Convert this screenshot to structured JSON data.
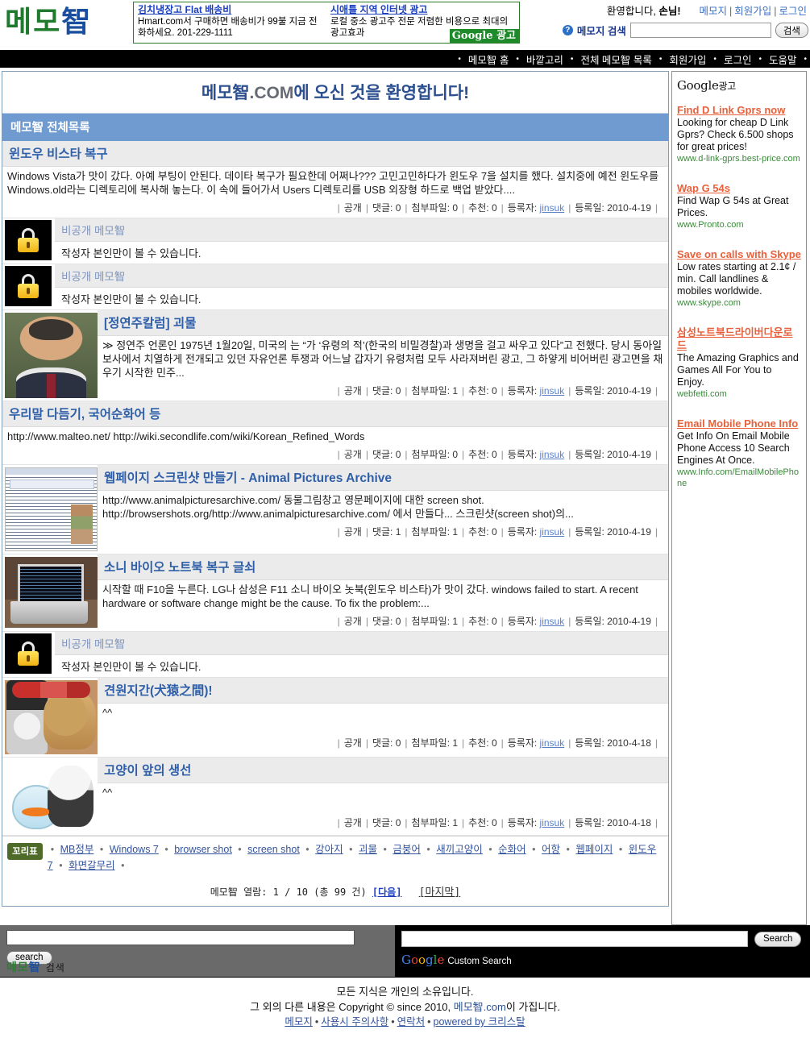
{
  "site": {
    "logo_part1": "메모",
    "logo_part2": "智",
    "title": "메모智.COM에 오신 것을 환영합니다!",
    "title_brand": "메모智",
    "title_dim": ".COM",
    "title_rest": "에 오신 것을 환영합니다!"
  },
  "top_ads": {
    "google_badge": "Google 광고",
    "items": [
      {
        "title": "김치냉장고 Flat 배송비",
        "text": "Hmart.com서 구매하면 배송비가 99불 지금 전화하세요. 201-229-1111"
      },
      {
        "title": "시애틀 지역 인터넷 광고",
        "text": "로컬 중소 광고주 전문 저렴한 비용으로 최대의 광고효과"
      }
    ]
  },
  "header": {
    "welcome": "환영합니다, ",
    "guest": "손님!",
    "links": [
      "메모지",
      "회원가입",
      "로그인"
    ],
    "search_label": "메모지 검색",
    "search_value": "",
    "search_button": "검색",
    "help_icon": "?"
  },
  "nav": {
    "items": [
      "메모智 홈",
      "바깥고리",
      "전체 메모智 목록",
      "회원가입",
      "로그인",
      "도움말"
    ]
  },
  "list": {
    "heading": "메모智 전체목록",
    "meta_labels": {
      "visibility": "공개",
      "comments": "댓글",
      "attachments": "첨부파일",
      "recommend": "추천",
      "author": "등록자",
      "date": "등록일"
    },
    "private_title": "비공개 메모智",
    "private_text": "작성자 본인만이 볼 수 있습니다.",
    "posts": [
      {
        "type": "text",
        "title": "윈도우 비스타 복구",
        "desc": "Windows Vista가 맛이 갔다. 아예 부팅이 안된다. 데이타 복구가 필요한데 어쩌나??? 고민고민하다가 윈도우 7을 설치를 했다. 설치중에 예전 윈도우를 Windows.old라는 디렉토리에 복사해 놓는다. 이 속에 들어가서 Users 디렉토리를 USB 외장형 하드로 백업 받았다....",
        "visibility": "공개",
        "comments": "0",
        "attachments": "0",
        "recommend": "0",
        "author": "jinsuk",
        "date": "2010-4-19"
      },
      {
        "type": "private"
      },
      {
        "type": "private"
      },
      {
        "type": "image",
        "thumb": "person-photo",
        "title": "[정연주칼럼] 괴물",
        "desc": "≫ 정연주 언론인 1975년 1월20일, 미국의 는 “가 ‘유령의 적’(한국의 비밀경찰)과 생명을 걸고 싸우고 있다”고 전했다. 당시 동아일보사에서 치열하게 전개되고 있던 자유언론 투쟁과 어느날 갑자기 유령처럼 모두 사라져버린 광고, 그 하얗게 비어버린 광고면을 채우기 시작한 민주...",
        "visibility": "공개",
        "comments": "0",
        "attachments": "1",
        "recommend": "0",
        "author": "jinsuk",
        "date": "2010-4-19"
      },
      {
        "type": "text",
        "title": "우리말 다듬기, 국어순화어 등",
        "desc": "http://www.malteo.net/ http://wiki.secondlife.com/wiki/Korean_Refined_Words",
        "visibility": "공개",
        "comments": "0",
        "attachments": "0",
        "recommend": "0",
        "author": "jinsuk",
        "date": "2010-4-19"
      },
      {
        "type": "image",
        "thumb": "webpage-screenshot",
        "title": "웹페이지 스크린샷 만들기 - Animal Pictures Archive",
        "desc": "http://www.animalpicturesarchive.com/ 동물그림창고 영문페이지에 대한 screen shot. http://browsershots.org/http://www.animalpicturesarchive.com/ 에서 만들다... 스크린샷(screen shot)의...",
        "visibility": "공개",
        "comments": "1",
        "attachments": "1",
        "recommend": "0",
        "author": "jinsuk",
        "date": "2010-4-19"
      },
      {
        "type": "image",
        "thumb": "laptop-photo",
        "title": "소니 바이오 노트북 복구 글쇠",
        "desc": "시작할 때 F10을 누른다. LG나 삼성은 F11 소니 바이오 놋북(윈도우 비스타)가 맛이 갔다. windows failed to start. A recent hardware or software change might be the cause. To fix the problem:...",
        "visibility": "공개",
        "comments": "0",
        "attachments": "1",
        "recommend": "0",
        "author": "jinsuk",
        "date": "2010-4-19"
      },
      {
        "type": "private"
      },
      {
        "type": "image",
        "thumb": "puppy-kitten-photo",
        "title": "견원지간(犬猿之間)!",
        "desc": "^^",
        "visibility": "공개",
        "comments": "0",
        "attachments": "1",
        "recommend": "0",
        "author": "jinsuk",
        "date": "2010-4-18"
      },
      {
        "type": "image",
        "thumb": "cat-fishbowl-photo",
        "title": "고양이 앞의 생선",
        "desc": "^^",
        "visibility": "공개",
        "comments": "0",
        "attachments": "1",
        "recommend": "0",
        "author": "jinsuk",
        "date": "2010-4-18"
      }
    ]
  },
  "tags": {
    "label": "꼬리표",
    "items": [
      "MB정부",
      "Windows 7",
      "browser shot",
      "screen shot",
      "강아지",
      "괴물",
      "금붕어",
      "새끼고양이",
      "순화어",
      "어항",
      "웹페이지",
      "윈도우 7",
      "화면갈무리"
    ]
  },
  "paging": {
    "prefix": "메모智 열람:",
    "current": "1",
    "slash": "/",
    "total_pages": "10",
    "count_text": "(총 99 건)",
    "next": "[다음]",
    "last": "[마지막]"
  },
  "sidebar": {
    "google_label": "Google",
    "google_label_kr": "광고",
    "ads": [
      {
        "title": "Find D Link Gprs now",
        "desc": "Looking for cheap D Link Gprs? Check 6.500 shops for great prices!",
        "url": "www.d-link-gprs.best-price.com"
      },
      {
        "title": "Wap G 54s",
        "desc": "Find Wap G 54s at Great Prices.",
        "url": "www.Pronto.com"
      },
      {
        "title": "Save on calls with Skype",
        "desc": "Low rates starting at 2.1¢ / min. Call landlines & mobiles worldwide.",
        "url": "www.skype.com"
      },
      {
        "title": "삼성노트북드라이버다운로드",
        "desc": "The Amazing Graphics and Games All For You to Enjoy.",
        "url": "webfetti.com"
      },
      {
        "title": "Email Mobile Phone Info",
        "desc": "Get Info On Email Mobile Phone Access 10 Search Engines At Once.",
        "url": "www.Info.com/EmailMobilePhone"
      }
    ]
  },
  "bottom_search": {
    "left_value": "",
    "left_button": "search",
    "left_logo1": "메모",
    "left_logo2": "智",
    "left_logo_kr": "검색",
    "right_value": "",
    "right_button": "Search",
    "custom_search": "Custom Search"
  },
  "footer": {
    "line1": "모든 지식은 개인의 소유입니다.",
    "line2_a": "그 외의 다른 내용은 Copyright © since 2010, ",
    "line2_brand": "메모智.com",
    "line2_b": "이 가집니다.",
    "links": [
      "메모지",
      "사용시 주의사항",
      "연락처",
      "powered by 크리스탈"
    ]
  }
}
